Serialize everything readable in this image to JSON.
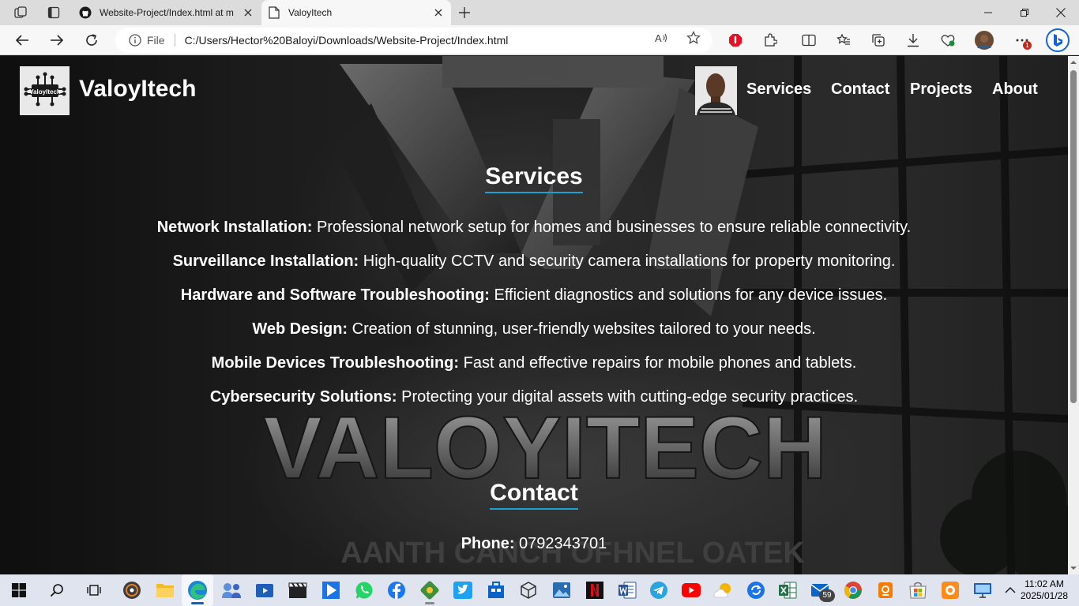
{
  "browser": {
    "tabs": [
      {
        "title": "Website-Project/Index.html at m",
        "state": "inactive",
        "icon": "github-icon"
      },
      {
        "title": "ValoyItech",
        "state": "active",
        "icon": "page-icon"
      }
    ],
    "address": {
      "scheme_label": "File",
      "url": "C:/Users/Hector%20Baloyi/Downloads/Website-Project/Index.html"
    },
    "notification_badge": "1"
  },
  "site": {
    "logo_text": "ValoyItech",
    "name": "ValoyItech",
    "nav": [
      "Services",
      "Contact",
      "Projects",
      "About"
    ]
  },
  "services": {
    "title": "Services",
    "items": [
      {
        "name": "Network Installation:",
        "desc": " Professional network setup for homes and businesses to ensure reliable connectivity."
      },
      {
        "name": "Surveillance Installation:",
        "desc": " High-quality CCTV and security camera installations for property monitoring."
      },
      {
        "name": "Hardware and Software Troubleshooting:",
        "desc": " Efficient diagnostics and solutions for any device issues."
      },
      {
        "name": "Web Design:",
        "desc": " Creation of stunning, user-friendly websites tailored to your needs."
      },
      {
        "name": "Mobile Devices Troubleshooting:",
        "desc": " Fast and effective repairs for mobile phones and tablets."
      },
      {
        "name": "Cybersecurity Solutions:",
        "desc": " Protecting your digital assets with cutting-edge security practices."
      }
    ]
  },
  "contact": {
    "title": "Contact",
    "phone_label": "Phone:",
    "phone": " 0792343701"
  },
  "background_text": {
    "brand": "VALOYITECH",
    "tagline": "AANTH CANCH OFHNEL OATEK"
  },
  "taskbar": {
    "mail_badge": "59",
    "time": "11:02 AM",
    "date": "2025/01/28"
  },
  "colors": {
    "accent_underline": "#1ea0d6",
    "tab_strip": "#dcdcdc",
    "taskbar": "#dfe4ee"
  }
}
